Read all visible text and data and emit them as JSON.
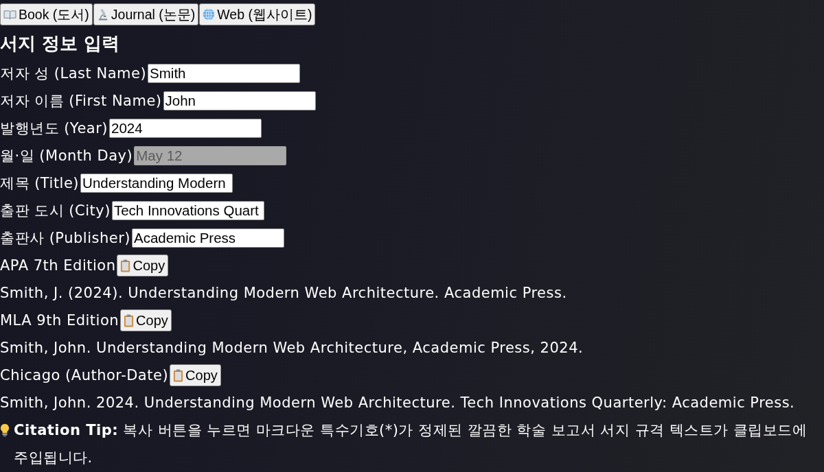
{
  "source_tabs": [
    {
      "kind": "book",
      "label": "Book (도서)"
    },
    {
      "kind": "journal",
      "label": "Journal (논문)"
    },
    {
      "kind": "web",
      "label": "Web (웹사이트)"
    }
  ],
  "form": {
    "heading": "서지 정보 입력",
    "fields": [
      {
        "label": "저자 성 (Last Name)",
        "value": "Smith",
        "disabled": false
      },
      {
        "label": "저자 이름 (First Name)",
        "value": "John",
        "disabled": false
      },
      {
        "label": "발행년도 (Year)",
        "value": "2024",
        "disabled": false
      },
      {
        "label": "월·일 (Month Day)",
        "placeholder": "May 12",
        "disabled": true
      },
      {
        "label": "제목 (Title)",
        "value": "Understanding Modern",
        "disabled": false
      },
      {
        "label": "출판 도시 (City)",
        "value": "Tech Innovations Quart",
        "disabled": false
      },
      {
        "label": "출판사 (Publisher)",
        "value": "Academic Press",
        "disabled": false
      }
    ]
  },
  "citations": [
    {
      "style": "APA 7th Edition",
      "copy_button": "Copy",
      "text": "Smith, J. (2024). Understanding Modern Web Architecture. Academic Press."
    },
    {
      "style": "MLA 9th Edition",
      "copy_button": "Copy",
      "text": "Smith, John. Understanding Modern Web Architecture, Academic Press, 2024."
    },
    {
      "style": "Chicago (Author-Date)",
      "copy_button": "Copy",
      "text": "Smith, John. 2024. Understanding Modern Web Architecture. Tech Innovations Quarterly: Academic Press."
    }
  ],
  "tip": {
    "text": "**Citation Tip:** 복사 버튼을 누르면 마크다운 특수기호(*)가 정제된 깔끔한 학술 보고서 서지 규격 텍스트가 클립보드에 주입됩니다."
  }
}
